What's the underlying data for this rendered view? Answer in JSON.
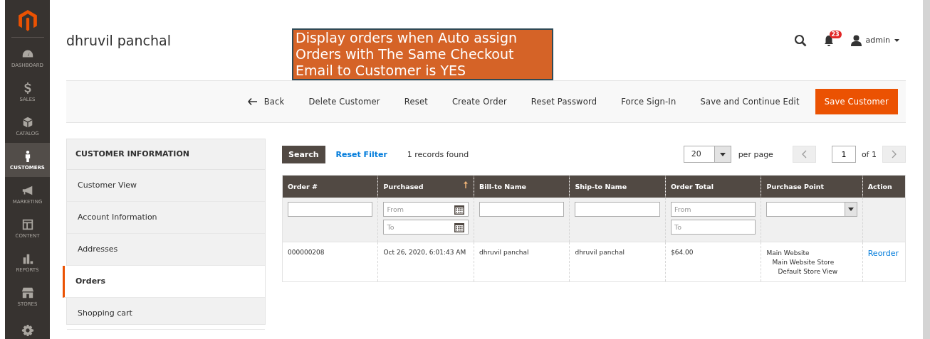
{
  "nav": [
    {
      "label": "DASHBOARD",
      "kind": "gauge",
      "selected": false
    },
    {
      "label": "SALES",
      "kind": "dollar",
      "selected": false
    },
    {
      "label": "CATALOG",
      "kind": "box",
      "selected": false
    },
    {
      "label": "CUSTOMERS",
      "kind": "person",
      "selected": true
    },
    {
      "label": "MARKETING",
      "kind": "megaphone",
      "selected": false
    },
    {
      "label": "CONTENT",
      "kind": "layout",
      "selected": false
    },
    {
      "label": "REPORTS",
      "kind": "bars",
      "selected": false
    },
    {
      "label": "STORES",
      "kind": "store",
      "selected": false
    },
    {
      "kind": "gear",
      "selected": false
    }
  ],
  "page_title": "dhruvil panchal",
  "annotation": "Display orders when Auto assign Orders with The Same Checkout Email to Customer is YES",
  "header": {
    "notifications": "23",
    "user": "admin"
  },
  "actions": [
    {
      "label": "Back",
      "kind": "back"
    },
    {
      "label": "Delete Customer",
      "kind": "plain"
    },
    {
      "label": "Reset",
      "kind": "plain"
    },
    {
      "label": "Create Order",
      "kind": "plain"
    },
    {
      "label": "Reset Password",
      "kind": "plain"
    },
    {
      "label": "Force Sign-In",
      "kind": "plain"
    },
    {
      "label": "Save and Continue Edit",
      "kind": "plain"
    },
    {
      "label": "Save Customer",
      "kind": "primary"
    }
  ],
  "tabs": {
    "title": "CUSTOMER INFORMATION",
    "items": [
      {
        "label": "Customer View",
        "selected": false
      },
      {
        "label": "Account Information",
        "selected": false
      },
      {
        "label": "Addresses",
        "selected": false
      },
      {
        "label": "Orders",
        "selected": true
      },
      {
        "label": "Shopping cart",
        "selected": false
      }
    ]
  },
  "grid": {
    "search": "Search",
    "reset_filter": "Reset Filter",
    "records": "1 records found",
    "per_page": {
      "value": "20",
      "label": "per page"
    },
    "page": {
      "value": "1",
      "of": "of 1"
    },
    "columns": [
      {
        "label": "Order #",
        "sorted": false,
        "kind": "text"
      },
      {
        "label": "Purchased",
        "sorted": true,
        "kind": "date",
        "placeholders": [
          "From",
          "To"
        ]
      },
      {
        "label": "Bill-to Name",
        "sorted": false,
        "kind": "text"
      },
      {
        "label": "Ship-to Name",
        "sorted": false,
        "kind": "text"
      },
      {
        "label": "Order Total",
        "sorted": false,
        "kind": "range",
        "placeholders": [
          "From",
          "To"
        ]
      },
      {
        "label": "Purchase Point",
        "sorted": false,
        "kind": "select"
      },
      {
        "label": "Action",
        "sorted": false,
        "kind": "none"
      }
    ],
    "rows": [
      {
        "order": "000000208",
        "purchased": "Oct 26, 2020, 6:01:43 AM",
        "bill_to": "dhruvil panchal",
        "ship_to": "dhruvil panchal",
        "total": "$64.00",
        "purchase_point": [
          "Main Website",
          "Main Website Store",
          "Default Store View"
        ],
        "action": "Reorder"
      }
    ]
  }
}
